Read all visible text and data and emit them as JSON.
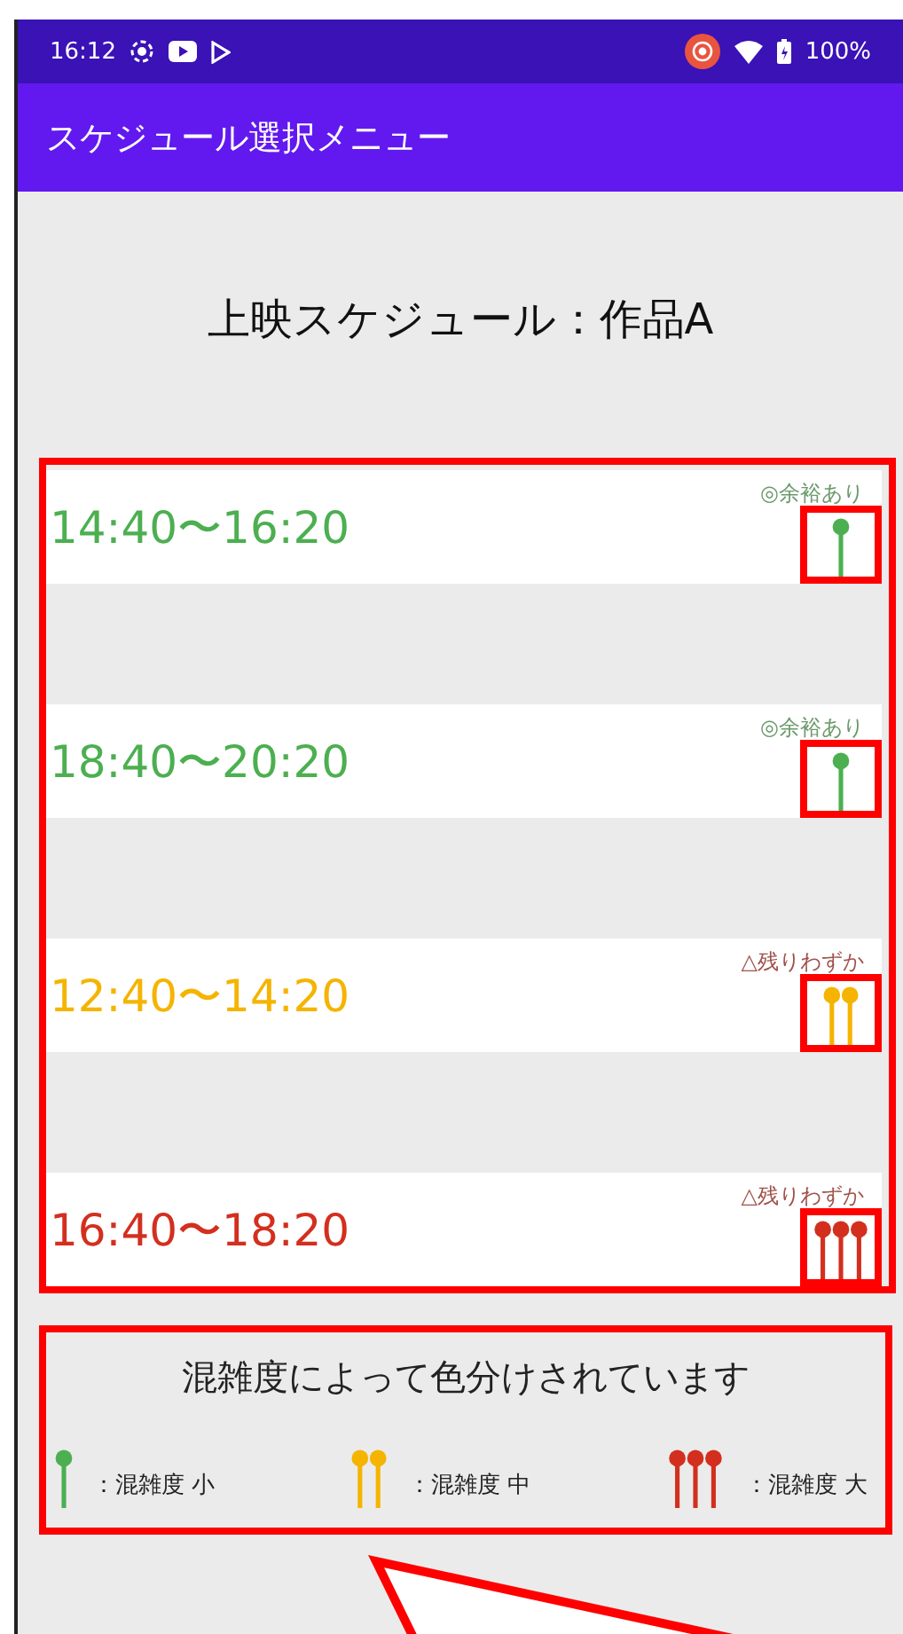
{
  "status_bar": {
    "time": "16:12",
    "battery": "100%"
  },
  "app_bar": {
    "title": "スケジュール選択メニュー"
  },
  "heading": "上映スケジュール：作品A",
  "sessions": [
    {
      "time": "14:40〜16:20",
      "availability": "◎余裕あり",
      "kind": "low",
      "color": "#4caf50"
    },
    {
      "time": "18:40〜20:20",
      "availability": "◎余裕あり",
      "kind": "low",
      "color": "#4caf50"
    },
    {
      "time": "12:40〜14:20",
      "availability": "△残りわずか",
      "kind": "medium",
      "color": "#f5b400"
    },
    {
      "time": "16:40〜18:20",
      "availability": "△残りわずか",
      "kind": "high",
      "color": "#d32f1f"
    }
  ],
  "legend": {
    "title": "混雑度によって色分けされています",
    "items": [
      {
        "kind": "low",
        "color": "#4caf50",
        "label": "：混雑度 小"
      },
      {
        "kind": "medium",
        "color": "#f5b400",
        "label": "：混雑度 中"
      },
      {
        "kind": "high",
        "color": "#d32f1f",
        "label": "：混雑度 大"
      }
    ]
  }
}
